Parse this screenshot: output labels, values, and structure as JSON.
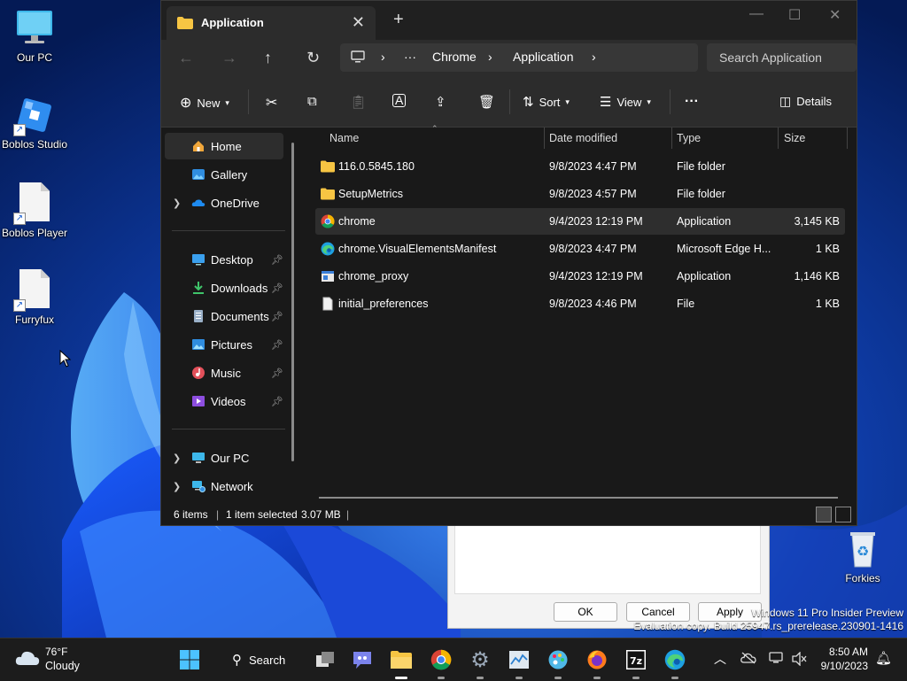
{
  "desktop": {
    "icons": [
      {
        "label": "Our PC",
        "icon": "monitor-icon"
      },
      {
        "label": "Boblos Studio",
        "icon": "studio-icon"
      },
      {
        "label": "Boblos Player",
        "icon": "document-icon"
      },
      {
        "label": "Furryfux",
        "icon": "document-icon"
      },
      {
        "label": "Forkies",
        "icon": "recycle-bin-icon"
      }
    ],
    "insider_line1": "Windows 11 Pro Insider Preview",
    "insider_line2": "Evaluation copy. Build 25947.rs_prerelease.230901-1416"
  },
  "dialog": {
    "ok": "OK",
    "cancel": "Cancel",
    "apply": "Apply"
  },
  "window": {
    "tab_title": "Application",
    "address": {
      "crumbs": [
        "Chrome",
        "Application"
      ],
      "more": "···"
    },
    "search_placeholder": "Search Application",
    "toolbar": {
      "new_label": "New",
      "sort_label": "Sort",
      "view_label": "View",
      "more_label": "···",
      "details_label": "Details"
    },
    "nav": {
      "home": "Home",
      "gallery": "Gallery",
      "onedrive": "OneDrive",
      "quick": [
        "Desktop",
        "Downloads",
        "Documents",
        "Pictures",
        "Music",
        "Videos"
      ],
      "ourpc": "Our PC",
      "network": "Network"
    },
    "columns": [
      "Name",
      "Date modified",
      "Type",
      "Size"
    ],
    "files": [
      {
        "name": "116.0.5845.180",
        "date": "9/8/2023 4:47 PM",
        "type": "File folder",
        "size": "",
        "icon": "folder-icon"
      },
      {
        "name": "SetupMetrics",
        "date": "9/8/2023 4:57 PM",
        "type": "File folder",
        "size": "",
        "icon": "folder-icon"
      },
      {
        "name": "chrome",
        "date": "9/4/2023 12:19 PM",
        "type": "Application",
        "size": "3,145 KB",
        "icon": "chrome-icon"
      },
      {
        "name": "chrome.VisualElementsManifest",
        "date": "9/8/2023 4:47 PM",
        "type": "Microsoft Edge H...",
        "size": "1 KB",
        "icon": "edge-icon"
      },
      {
        "name": "chrome_proxy",
        "date": "9/4/2023 12:19 PM",
        "type": "Application",
        "size": "1,146 KB",
        "icon": "app-window-icon"
      },
      {
        "name": "initial_preferences",
        "date": "9/8/2023 4:46 PM",
        "type": "File",
        "size": "1 KB",
        "icon": "file-icon"
      }
    ],
    "status": {
      "count": "6 items",
      "selected": "1 item selected",
      "size": "3.07 MB"
    }
  },
  "taskbar": {
    "weather_temp": "76°F",
    "weather_cond": "Cloudy",
    "search_label": "Search",
    "time": "8:50 AM",
    "date": "9/10/2023"
  }
}
